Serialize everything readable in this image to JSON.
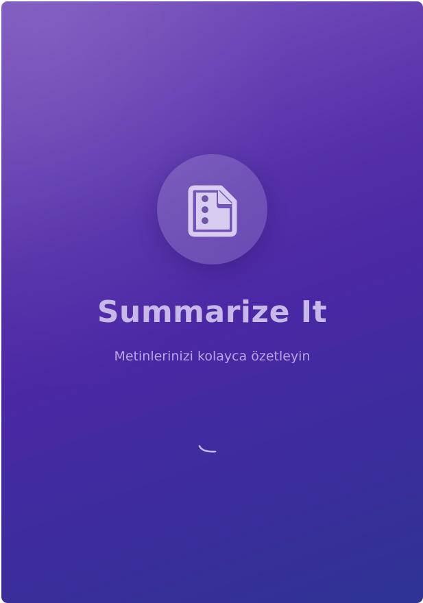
{
  "app": {
    "title": "Summarize It",
    "subtitle": "Metinlerinizi kolayca özetleyin"
  },
  "logo": {
    "icon": "document-icon"
  },
  "loading": {
    "icon": "loading-spinner"
  },
  "colors": {
    "gradient_start": "#7b55be",
    "gradient_mid": "#4b28a5",
    "gradient_end": "#2f3394",
    "title_text": "#c6b9e8",
    "subtitle_text": "#b8a6e4"
  }
}
